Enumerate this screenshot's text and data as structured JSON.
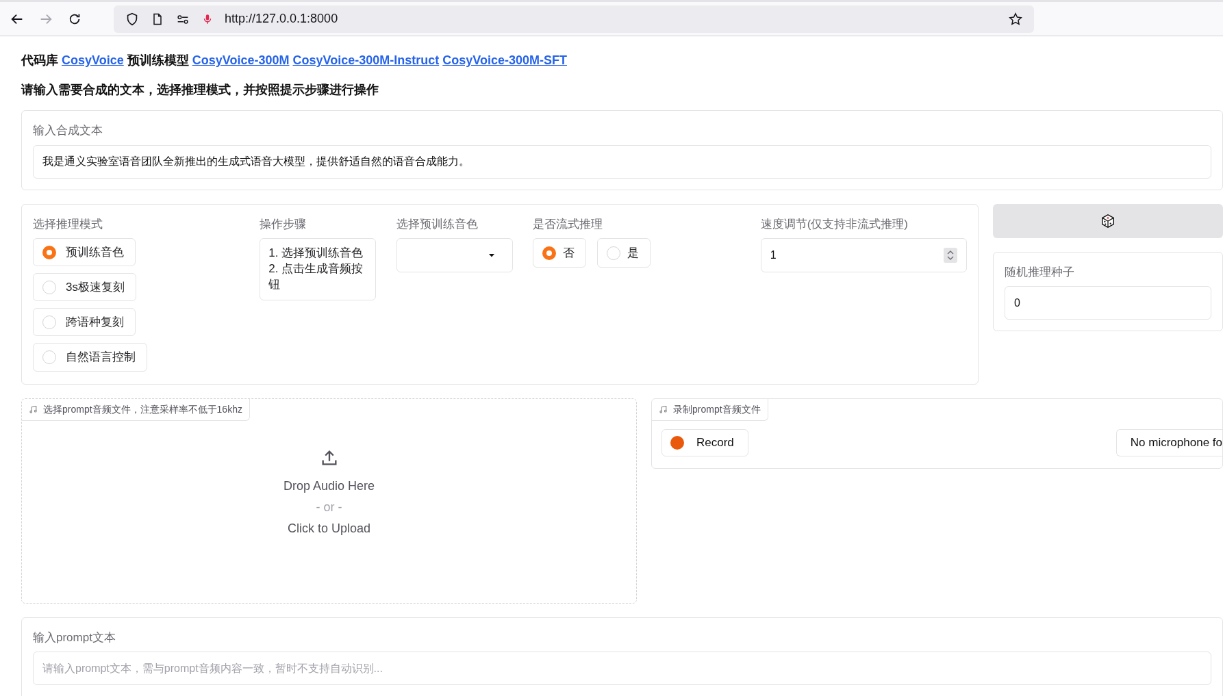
{
  "browser": {
    "url": "http://127.0.0.1:8000",
    "nav": [
      {
        "kind": "back",
        "disabled": false
      },
      {
        "kind": "forward",
        "disabled": true
      },
      {
        "kind": "reload",
        "disabled": false
      }
    ]
  },
  "header": [
    {
      "kind": "text",
      "text": "代码库"
    },
    {
      "kind": "link",
      "text": "CosyVoice"
    },
    {
      "kind": "text",
      "text": "预训练模型"
    },
    {
      "kind": "link",
      "text": "CosyVoice-300M"
    },
    {
      "kind": "link",
      "text": "CosyVoice-300M-Instruct"
    },
    {
      "kind": "link",
      "text": "CosyVoice-300M-SFT"
    }
  ],
  "instruction": "请输入需要合成的文本，选择推理模式，并按照提示步骤进行操作",
  "synth_text": {
    "label": "输入合成文本",
    "value": "我是通义实验室语音团队全新推出的生成式语音大模型，提供舒适自然的语音合成能力。"
  },
  "mode": {
    "label": "选择推理模式",
    "options": [
      {
        "label": "预训练音色",
        "selected": true
      },
      {
        "label": "3s极速复刻",
        "selected": false
      },
      {
        "label": "跨语种复刻",
        "selected": false
      },
      {
        "label": "自然语言控制",
        "selected": false
      }
    ]
  },
  "steps": {
    "label": "操作步骤",
    "lines": [
      "1. 选择预训练音色",
      "2. 点击生成音频按钮"
    ]
  },
  "voice": {
    "label": "选择预训练音色"
  },
  "streaming": {
    "label": "是否流式推理",
    "options": [
      {
        "label": "否",
        "selected": true
      },
      {
        "label": "是",
        "selected": false
      }
    ]
  },
  "speed": {
    "label": "速度调节(仅支持非流式推理)",
    "value": "1"
  },
  "seed": {
    "label": "随机推理种子",
    "value": "0"
  },
  "upload": {
    "label": "选择prompt音频文件，注意采样率不低于16khz",
    "drop": "Drop Audio Here",
    "or": "- or -",
    "click": "Click to Upload"
  },
  "record": {
    "label": "录制prompt音频文件",
    "button": "Record",
    "microphone": "No microphone fo"
  },
  "prompt_text": {
    "label": "输入prompt文本",
    "placeholder": "请输入prompt文本，需与prompt音频内容一致，暂时不支持自动识别..."
  }
}
